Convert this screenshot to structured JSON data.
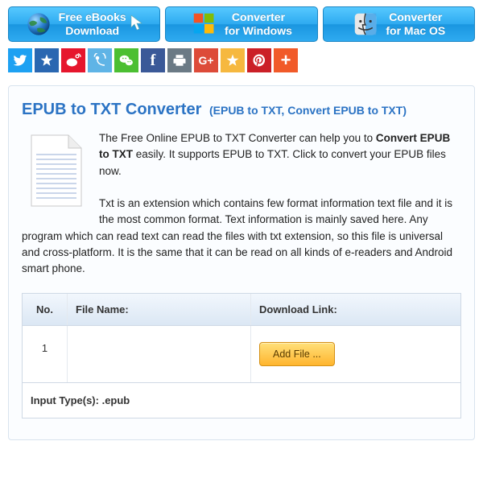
{
  "topButtons": [
    {
      "line1": "Free eBooks",
      "line2": "Download"
    },
    {
      "line1": "Converter",
      "line2": "for Windows"
    },
    {
      "line1": "Converter",
      "line2": "for Mac OS"
    }
  ],
  "shareIcons": [
    "twitter",
    "qzone-star",
    "weibo",
    "tencent-weibo",
    "wechat",
    "facebook",
    "print",
    "googleplus",
    "star",
    "pinterest",
    "more"
  ],
  "title": "EPUB to TXT Converter",
  "subtitle": "(EPUB to TXT, Convert EPUB to TXT)",
  "intro_prefix": "The Free Online EPUB to TXT Converter can help you to ",
  "intro_bold": "Convert EPUB to TXT",
  "intro_suffix": " easily. It supports EPUB to TXT. Click to convert your EPUB files now.",
  "intro_para2": "Txt is an extension which contains few format information text file and it is the most common format. Text information is mainly saved here. Any program which can read text can read the files with txt extension, so this file is universal and cross-platform. It is the same that it can be read on all kinds of e-readers and Android smart phone.",
  "table": {
    "headers": {
      "no": "No.",
      "filename": "File Name:",
      "download": "Download Link:"
    },
    "rows": [
      {
        "no": "1",
        "filename": "",
        "button": "Add File ..."
      }
    ],
    "footer": "Input Type(s): .epub"
  }
}
